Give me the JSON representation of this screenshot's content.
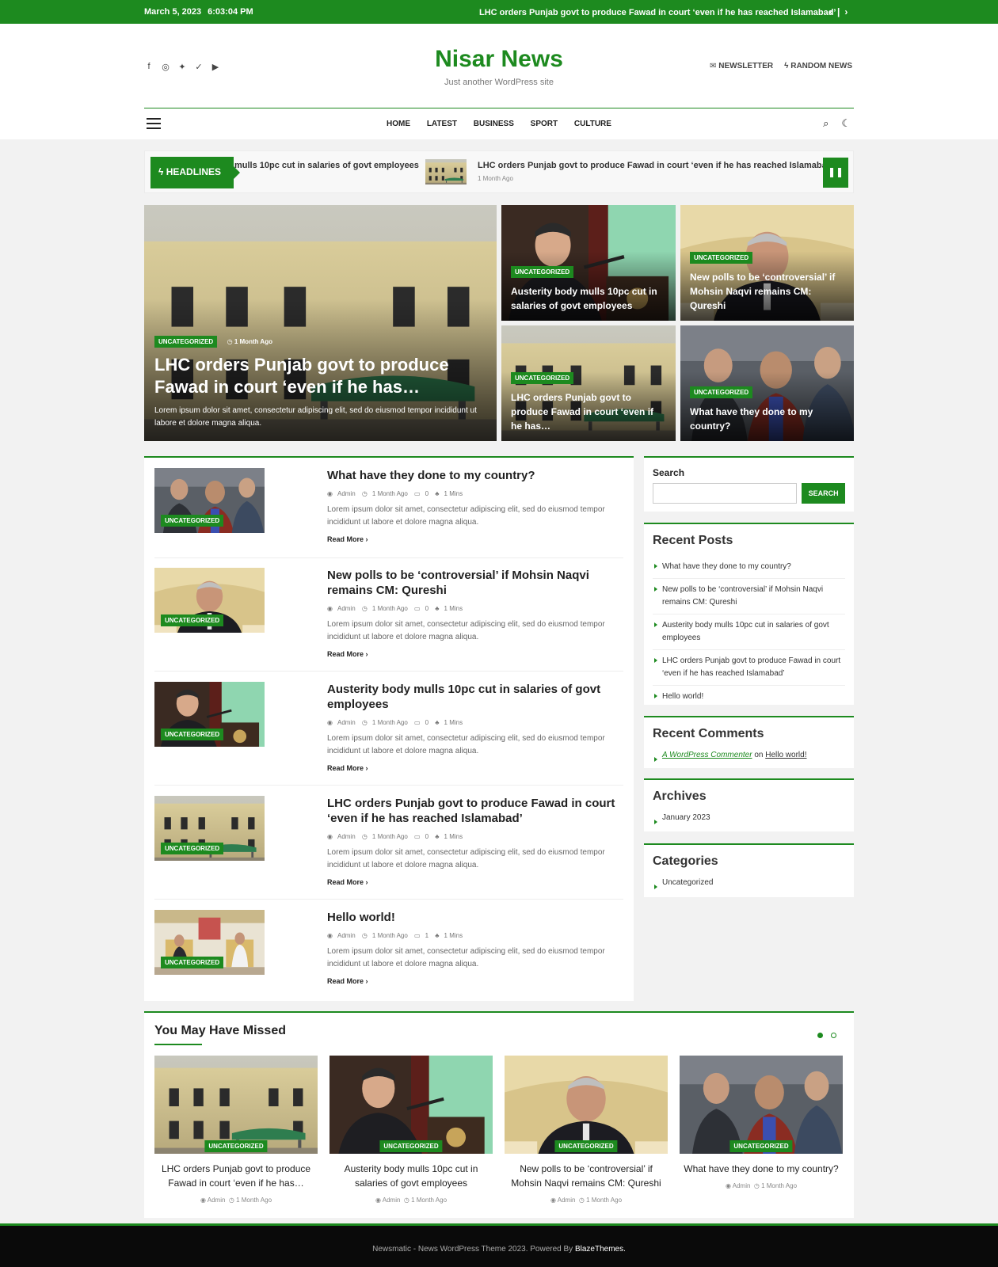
{
  "topbar": {
    "date": "March 5, 2023",
    "time": "6:03:04 PM",
    "ticker": "LHC orders Punjab govt to produce Fawad in court ‘even if he has reached Islamabad’",
    "prev": "‹",
    "sep": "|",
    "next": "›"
  },
  "header": {
    "site_title": "Nisar News",
    "tagline": "Just another WordPress site",
    "newsletter_label": "NEWSLETTER",
    "random_label": "RANDOM NEWS",
    "social_icons": [
      "facebook-icon",
      "instagram-icon",
      "twitter-icon",
      "vk-icon",
      "youtube-icon"
    ]
  },
  "nav": {
    "items": [
      "HOME",
      "LATEST",
      "BUSINESS",
      "SPORT",
      "CULTURE"
    ]
  },
  "headlines": {
    "label": "HEADLINES",
    "item1": "mulls 10pc cut in salaries of govt employees",
    "item2": "LHC orders Punjab govt to produce Fawad in court ‘even if he has reached Islamabad’",
    "item2_meta": "1 Month Ago"
  },
  "hero": {
    "main": {
      "category": "UNCATEGORIZED",
      "time": "1 Month Ago",
      "title": "LHC orders Punjab govt to produce Fawad in court ‘even if he has…",
      "excerpt": "Lorem ipsum dolor sit amet, consectetur adipiscing elit, sed do eiusmod tempor incididunt ut labore et dolore magna aliqua."
    },
    "tiles": [
      {
        "category": "UNCATEGORIZED",
        "title": "Austerity body mulls 10pc cut in salaries of govt employees"
      },
      {
        "category": "UNCATEGORIZED",
        "title": "New polls to be ‘controversial’ if Mohsin Naqvi remains CM: Qureshi"
      },
      {
        "category": "UNCATEGORIZED",
        "title": "LHC orders Punjab govt to produce Fawad in court ‘even if he has…"
      },
      {
        "category": "UNCATEGORIZED",
        "title": "What have they done to my country?"
      }
    ]
  },
  "posts": [
    {
      "title": "What have they done to my country?",
      "category": "UNCATEGORIZED",
      "author": "Admin",
      "time": "1 Month Ago",
      "comments": "0",
      "read": "1 Mins",
      "excerpt": "Lorem ipsum dolor sit amet, consectetur adipiscing elit, sed do eiusmod tempor incididunt ut labore et dolore magna aliqua.",
      "more": "Read More"
    },
    {
      "title": "New polls to be ‘controversial’ if Mohsin Naqvi remains CM: Qureshi",
      "category": "UNCATEGORIZED",
      "author": "Admin",
      "time": "1 Month Ago",
      "comments": "0",
      "read": "1 Mins",
      "excerpt": "Lorem ipsum dolor sit amet, consectetur adipiscing elit, sed do eiusmod tempor incididunt ut labore et dolore magna aliqua.",
      "more": "Read More"
    },
    {
      "title": "Austerity body mulls 10pc cut in salaries of govt employees",
      "category": "UNCATEGORIZED",
      "author": "Admin",
      "time": "1 Month Ago",
      "comments": "0",
      "read": "1 Mins",
      "excerpt": "Lorem ipsum dolor sit amet, consectetur adipiscing elit, sed do eiusmod tempor incididunt ut labore et dolore magna aliqua.",
      "more": "Read More"
    },
    {
      "title": "LHC orders Punjab govt to produce Fawad in court ‘even if he has reached Islamabad’",
      "category": "UNCATEGORIZED",
      "author": "Admin",
      "time": "1 Month Ago",
      "comments": "0",
      "read": "1 Mins",
      "excerpt": "Lorem ipsum dolor sit amet, consectetur adipiscing elit, sed do eiusmod tempor incididunt ut labore et dolore magna aliqua.",
      "more": "Read More"
    },
    {
      "title": "Hello world!",
      "category": "UNCATEGORIZED",
      "author": "Admin",
      "time": "1 Month Ago",
      "comments": "1",
      "read": "1 Mins",
      "excerpt": "Lorem ipsum dolor sit amet, consectetur adipiscing elit, sed do eiusmod tempor incididunt ut labore et dolore magna aliqua.",
      "more": "Read More"
    }
  ],
  "sidebar": {
    "search_label": "Search",
    "search_value": "",
    "search_button": "SEARCH",
    "recent_posts_title": "Recent Posts",
    "recent_posts": [
      "What have they done to my country?",
      "New polls to be ‘controversial’ if Mohsin Naqvi remains CM: Qureshi",
      "Austerity body mulls 10pc cut in salaries of govt employees",
      "LHC orders Punjab govt to produce Fawad in court ‘even if he has reached Islamabad’",
      "Hello world!"
    ],
    "recent_comments_title": "Recent Comments",
    "comment_author": "A WordPress Commenter",
    "comment_on": "on",
    "comment_post": "Hello world!",
    "archives_title": "Archives",
    "archives": [
      "January 2023"
    ],
    "categories_title": "Categories",
    "categories": [
      "Uncategorized"
    ]
  },
  "missed": {
    "title": "You May Have Missed",
    "cards": [
      {
        "category": "UNCATEGORIZED",
        "title": "LHC orders Punjab govt to produce Fawad in court ‘even if he has…",
        "author": "Admin",
        "time": "1 Month Ago"
      },
      {
        "category": "UNCATEGORIZED",
        "title": "Austerity body mulls 10pc cut in salaries of govt employees",
        "author": "Admin",
        "time": "1 Month Ago"
      },
      {
        "category": "UNCATEGORIZED",
        "title": "New polls to be ‘controversial’ if Mohsin Naqvi remains CM: Qureshi",
        "author": "Admin",
        "time": "1 Month Ago"
      },
      {
        "category": "UNCATEGORIZED",
        "title": "What have they done to my country?",
        "author": "Admin",
        "time": "1 Month Ago"
      }
    ]
  },
  "footer": {
    "text": "Newsmatic - News WordPress Theme 2023. Powered By",
    "brand": "BlazeThemes."
  },
  "colors": {
    "accent": "#1d8a1f",
    "footer_bg": "#0a0a0a"
  }
}
